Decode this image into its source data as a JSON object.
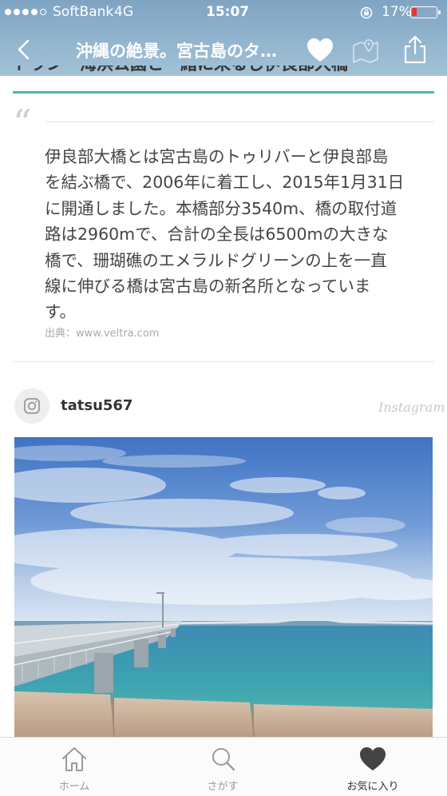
{
  "status_bar": {
    "carrier": "SoftBank",
    "network": "4G",
    "time": "15:07",
    "battery": "17%",
    "battery_level_fraction": 0.17,
    "signal_bars_filled": 4,
    "signal_bars_total": 5
  },
  "nav": {
    "title": "沖縄の絶景。宮古島のタ…",
    "icons": [
      "back-chevron-icon",
      "heart-icon",
      "map-pin-icon",
      "share-icon"
    ]
  },
  "article": {
    "clipped_heading": "トラン・海浜公園と一緒に来るじ伊良部大橋",
    "quote_lines": [
      "伊良部大橋とは宮古島のトゥリバーと伊良部島",
      "を結ぶ橋で、2006年に着工し、2015年1月31日",
      "に開通しました。本橋部分3540m、橋の取付道",
      "路は2960mで、合計の全長は6500mの大きな",
      "橋で、珊瑚礁のエメラルドグリーンの上を一直",
      "線に伸びる橋は宮古島の新名所となっていま",
      "す。"
    ],
    "source": "出典：www.veltra.com"
  },
  "instagram": {
    "username": "tatsu567",
    "brand": "Instagram"
  },
  "tabbar": {
    "tabs": [
      {
        "label": "ホーム",
        "icon": "home-icon"
      },
      {
        "label": "さがす",
        "icon": "search-icon"
      },
      {
        "label": "お気に入り",
        "icon": "heart-icon"
      }
    ]
  },
  "colors": {
    "accent_teal": "#4fb6b3",
    "header_blue": "#8fb2cc",
    "battery_red": "#e23a2e"
  }
}
